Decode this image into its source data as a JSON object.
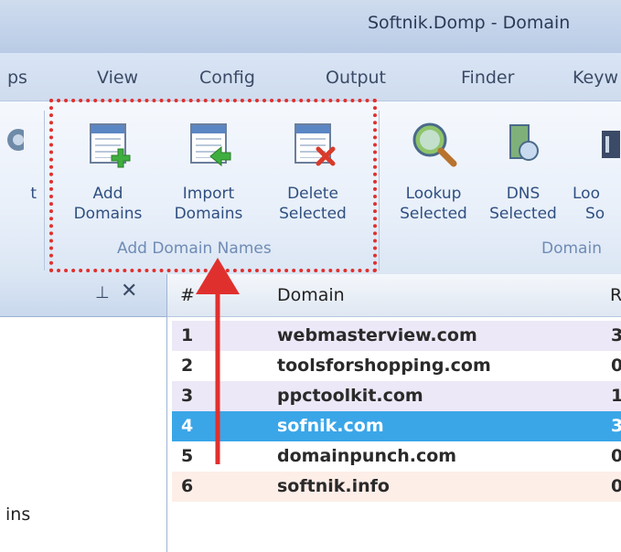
{
  "window": {
    "title": "Softnik.Domp - Domain"
  },
  "menu": {
    "tabs": [
      "ps",
      "View",
      "Config",
      "Output",
      "Finder",
      "Keyw"
    ]
  },
  "ribbon": {
    "buttons": [
      {
        "label1": "t",
        "label2": ""
      },
      {
        "label1": "Add",
        "label2": "Domains"
      },
      {
        "label1": "Import",
        "label2": "Domains"
      },
      {
        "label1": "Delete",
        "label2": "Selected"
      },
      {
        "label1": "Lookup",
        "label2": "Selected"
      },
      {
        "label1": "DNS",
        "label2": "Selected"
      },
      {
        "label1": "Loo",
        "label2": "So"
      }
    ],
    "groups": {
      "add": "Add Domain Names",
      "domain": "Domain"
    }
  },
  "leftpane": {
    "pin": "ᵖ",
    "close": "✕",
    "text1": "ins",
    "text2": ""
  },
  "grid": {
    "headers": {
      "num": "#",
      "domain": "Domain",
      "r": "R"
    },
    "rows": [
      {
        "num": "1",
        "domain": "webmasterview.com",
        "r": "3"
      },
      {
        "num": "2",
        "domain": "toolsforshopping.com",
        "r": "0"
      },
      {
        "num": "3",
        "domain": "ppctoolkit.com",
        "r": "1"
      },
      {
        "num": "4",
        "domain": "sofnik.com",
        "r": "3"
      },
      {
        "num": "5",
        "domain": "domainpunch.com",
        "r": "0"
      },
      {
        "num": "6",
        "domain": "softnik.info",
        "r": "0"
      }
    ],
    "row_colors": [
      "#ece8f7",
      "#ffffff",
      "#ece8f7",
      "#3aa6e8",
      "#ffffff",
      "#fdeee8"
    ],
    "selected_row": 4
  },
  "colors": {
    "highlight": "#e0302e",
    "arrow": "#e0302e",
    "selection": "#3aa6e8"
  }
}
